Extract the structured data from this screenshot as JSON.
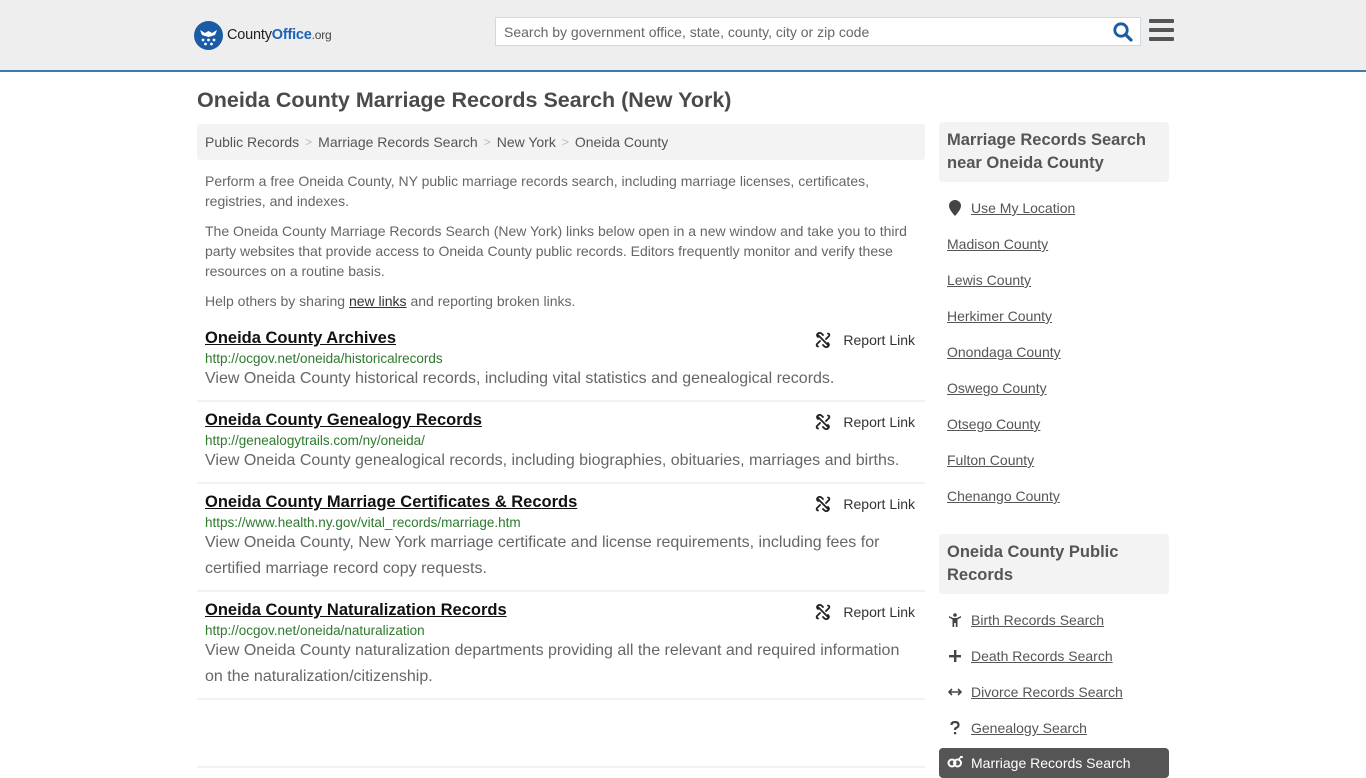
{
  "header": {
    "logo": {
      "brand_a": "County",
      "brand_b": "Office",
      "brand_c": ".org"
    },
    "search": {
      "placeholder": "Search by government office, state, county, city or zip code",
      "value": ""
    },
    "icons": {
      "search": "search-icon",
      "menu": "hamburger-menu-icon",
      "logo": "eagle-stars-logo-icon"
    }
  },
  "page": {
    "title": "Oneida County Marriage Records Search (New York)"
  },
  "breadcrumb": [
    {
      "label": "Public Records"
    },
    {
      "label": "Marriage Records Search"
    },
    {
      "label": "New York"
    },
    {
      "label": "Oneida County"
    }
  ],
  "breadcrumb_separator": ">",
  "intro": {
    "p1": "Perform a free Oneida County, NY public marriage records search, including marriage licenses, certificates, registries, and indexes.",
    "p2": "The Oneida County Marriage Records Search (New York) links below open in a new window and take you to third party websites that provide access to Oneida County public records. Editors frequently monitor and verify these resources on a routine basis.",
    "p3_before": "Help others by sharing ",
    "p3_link": "new links",
    "p3_after": " and reporting broken links."
  },
  "results": [
    {
      "title": "Oneida County Archives",
      "url": "http://ocgov.net/oneida/historicalrecords",
      "description": "View Oneida County historical records, including vital statistics and genealogical records.",
      "report_label": "Report Link"
    },
    {
      "title": "Oneida County Genealogy Records",
      "url": "http://genealogytrails.com/ny/oneida/",
      "description": "View Oneida County genealogical records, including biographies, obituaries, marriages and births.",
      "report_label": "Report Link"
    },
    {
      "title": "Oneida County Marriage Certificates & Records",
      "url": "https://www.health.ny.gov/vital_records/marriage.htm",
      "description": "View Oneida County, New York marriage certificate and license requirements, including fees for certified marriage record copy requests.",
      "report_label": "Report Link"
    },
    {
      "title": "Oneida County Naturalization Records",
      "url": "http://ocgov.net/oneida/naturalization",
      "description": "View Oneida County naturalization departments providing all the relevant and required information on the naturalization/citizenship.",
      "report_label": "Report Link"
    }
  ],
  "sidebar": {
    "nearby": {
      "heading": "Marriage Records Search near Oneida County",
      "use_location": "Use My Location",
      "counties": [
        "Madison County",
        "Lewis County",
        "Herkimer County",
        "Onondaga County",
        "Oswego County",
        "Otsego County",
        "Fulton County",
        "Chenango County"
      ]
    },
    "public_records": {
      "heading": "Oneida County Public Records",
      "items": [
        {
          "label": "Birth Records Search",
          "icon": "child-icon"
        },
        {
          "label": "Death Records Search",
          "icon": "plus-icon"
        },
        {
          "label": "Divorce Records Search",
          "icon": "arrows-horizontal-icon"
        },
        {
          "label": "Genealogy Search",
          "icon": "question-icon"
        }
      ],
      "active": {
        "label": "Marriage Records Search",
        "icon": "marriage-icon"
      }
    }
  },
  "colors": {
    "accent_blue": "#1a63b8",
    "header_border": "#3a7cad",
    "url_green": "#2d7a2d",
    "active_bg": "#555555"
  }
}
